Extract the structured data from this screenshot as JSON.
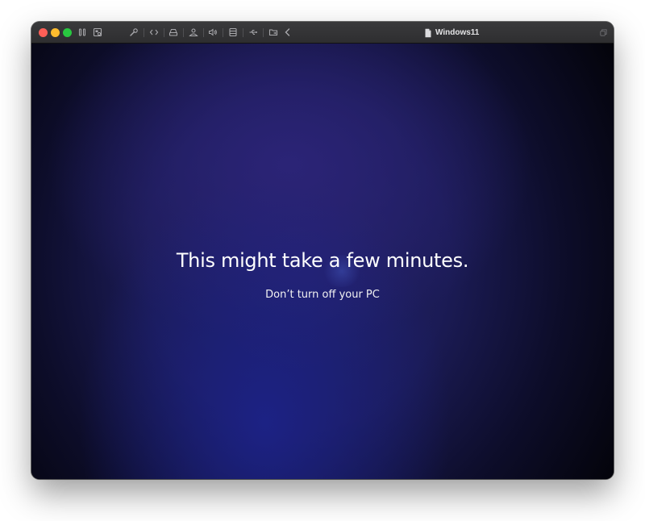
{
  "window": {
    "title": "Windows11",
    "toolbar_icons": [
      "pause-icon",
      "snapshot-icon",
      "settings-wrench-icon",
      "code-brackets-icon",
      "drive-icon",
      "user-account-icon",
      "speaker-icon",
      "storage-icon",
      "usb-icon",
      "folder-share-icon",
      "back-chevron-icon"
    ],
    "title_icon": "document-icon",
    "right_icon": "restore-window-icon"
  },
  "screen": {
    "headline": "This might take a few minutes.",
    "subline": "Don’t turn off your PC"
  },
  "colors": {
    "close": "#ff5f57",
    "minimize": "#febc2e",
    "zoom": "#28c840",
    "screen_background": "#1b1b55"
  }
}
